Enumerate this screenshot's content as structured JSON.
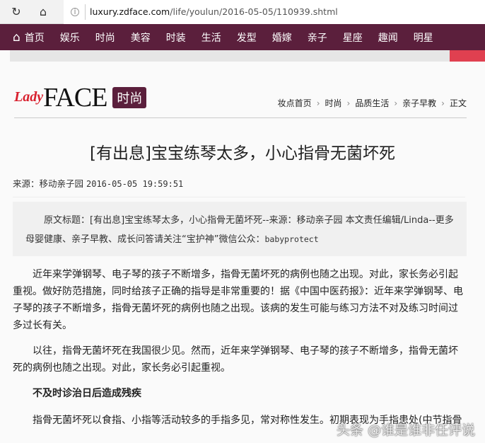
{
  "browser": {
    "url_host": "luxury.zdface.com",
    "url_path": "/life/youlun/2016-05-05/110939.shtml",
    "refresh": "↻",
    "home": "⌂",
    "info": "i"
  },
  "nav": {
    "home_icon": "⌂",
    "items": [
      "首页",
      "娱乐",
      "时尚",
      "美容",
      "时装",
      "生活",
      "发型",
      "婚嫁",
      "亲子",
      "星座",
      "趣闻",
      "明星"
    ]
  },
  "logo": {
    "lady": "Lady",
    "face": "FACE",
    "tag": "时尚"
  },
  "breadcrumb": [
    "妆点首页",
    "时尚",
    "品质生活",
    "亲子早教",
    "正文"
  ],
  "article": {
    "title": "[有出息]宝宝练琴太多，小心指骨无菌坏死",
    "source_label": "来源：移动亲子园",
    "datetime": "2016-05-05 19:59:51",
    "summary_a": "原文标题：[有出息]宝宝练琴太多，小心指骨无菌坏死--来源：移动亲子园 本文责任编辑/Linda--更多母婴健康、亲子早教、成长问答请关注“宝护神”微信公众：",
    "summary_b": "babyprotect",
    "p1": "近年来学弹钢琴、电子琴的孩子不断增多，指骨无菌坏死的病例也随之出现。对此，家长务必引起重视。做好防范措施，同时给孩子正确的指导是非常重要的！据《中国中医药报》：近年来学弹钢琴、电子琴的孩子不断增多，指骨无菌坏死的病例也随之出现。该病的发生可能与练习方法不对及练习时间过多过长有关。",
    "p2": "以往，指骨无菌坏死在我国很少见。然而，近年来学弹钢琴、电子琴的孩子不断增多，指骨无菌坏死的病例也随之出现。对此，家长务必引起重视。",
    "h": "不及时诊治日后造成残疾",
    "p3": "指骨无菌坏死以食指、小指等活动较多的手指多见，常对称性发生。初期表现为手指患处(中节指骨"
  },
  "watermark": "头条 @谁是谁非任评说"
}
